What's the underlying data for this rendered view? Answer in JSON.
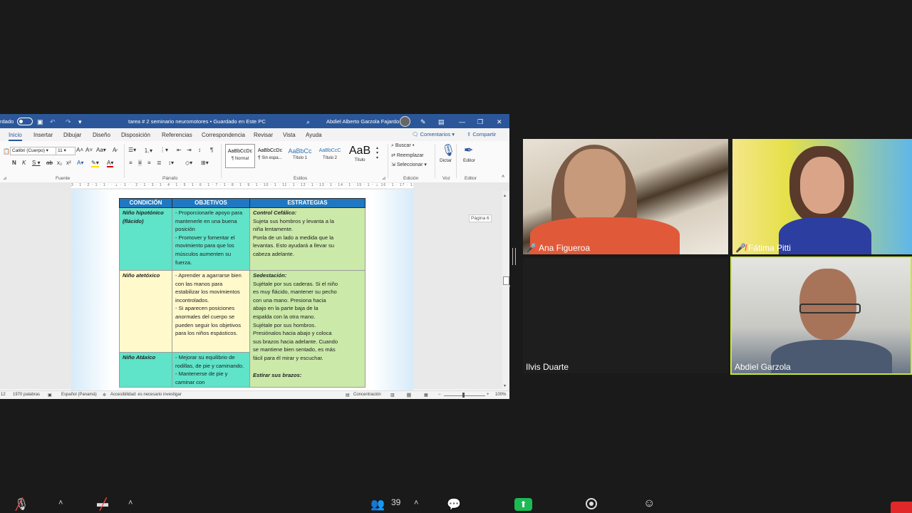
{
  "word": {
    "autosave_label": "rdado",
    "doc_title": "tarea # 2 seminario neuromotores • Guardado en Este PC",
    "user_name": "Abdiel Alberto Garzola Fajardo",
    "tabs": [
      "Inicio",
      "Insertar",
      "Dibujar",
      "Diseño",
      "Disposición",
      "Referencias",
      "Correspondencia",
      "Revisar",
      "Vista",
      "Ayuda"
    ],
    "comments_button": "Comentarios",
    "share_button": "Compartir",
    "font_name": "Calibri (Cuerpo)",
    "font_size": "11",
    "styles": [
      {
        "preview": "AaBbCcDc",
        "label": "¶ Normal"
      },
      {
        "preview": "AaBbCcDc",
        "label": "¶ Sin espa..."
      },
      {
        "preview": "AaBbCc",
        "label": "Título 1"
      },
      {
        "preview": "AaBbCcC",
        "label": "Título 2"
      },
      {
        "preview": "AaB",
        "label": "Título"
      }
    ],
    "edit_buttons": [
      "Buscar",
      "Reemplazar",
      "Seleccionar"
    ],
    "dictate_label": "Dictar",
    "editor_label": "Editor",
    "group_labels": {
      "fuente": "Fuente",
      "parrafo": "Párrafo",
      "estilos": "Estilos",
      "edicion": "Edición",
      "voz": "Voz",
      "editor": "Editor"
    },
    "ruler_text": "3 · 1 · 2 · 1 · 1 · · ⊥ · 1 · · 2 · 1 · 3 · 1 · 4 · 1 · 5 · 1 · 6 · 1 · 7 · 1 · 8 · 1 · 9 · 1 · 10 · 1 · 11 · 1 · 12 · 1 · 13 · 1 · 14 · 1 · 15 · 1 · ⊥ 16 · 1 · 17 · 1 · 18 ·",
    "page_indicator": "Página 6",
    "status": {
      "page_num": "12",
      "word_count": "1970 palabras",
      "language": "Español (Panamá)",
      "accessibility": "Accesibilidad: es necesario investigar",
      "focus": "Concentración",
      "zoom": "100%"
    },
    "table": {
      "headers": [
        "CONDICIÓN",
        "OBJETIVOS",
        "ESTRATEGIAS"
      ],
      "rows": [
        {
          "condition": "Niño hipotónico (flácido)",
          "objectives": "- Proporcionarle apoyo para mantenerle en una buena posición\n- Promover y fomentar el movimiento para que los músculos aumenten su fuerza.",
          "strategy_title": "Control Cefálico:",
          "strategy_text": "Sujeta sus hombros y levanta a la niña lentamente.\nPonla de un lado a medida que la levantas. Esto ayudará a llevar su cabeza adelante."
        },
        {
          "condition": "Niño atetóxico",
          "objectives": "- Aprender a agarrarse bien con las manos para estabilizar los movimientos incontrolados.\n- Si aparecen posiciones anormales del cuerpo se pueden seguir los objetivos para los niños espásticos.",
          "strategy_title": "Sedestación:",
          "strategy_text": "Sujétale por sus caderas. Si el niño es muy flácido, mantener su pecho con una mano. Presiona hacia abajo en la parte baja de la espalda con la otra mano.\nSujétale por sus hombros. Presiónalos hacia abajo y coloca sus brazos hacia adelante. Cuando se mantiene bien sentado, es más fácil para él mirar y escuchar."
        },
        {
          "condition": "Niño Atáxico",
          "objectives": "- Mejorar su equilibrio de rodillas, de pie y caminando.\n- Mantenerse de pie y caminar con",
          "strategy_title": "Estirar sus brazos:",
          "strategy_text": ""
        }
      ]
    }
  },
  "participants": [
    {
      "name": "Ana Figueroa",
      "muted": true
    },
    {
      "name": "Fátima Pitti",
      "muted": true
    },
    {
      "name": "Ilvis Duarte",
      "muted": false
    },
    {
      "name": "Abdiel Garzola",
      "muted": false
    }
  ],
  "toolbar": {
    "participant_count": "39",
    "icons": [
      "mic-muted-icon",
      "video-off-icon",
      "participants-icon",
      "chat-icon",
      "share-screen-icon",
      "record-icon",
      "reactions-icon"
    ]
  },
  "colors": {
    "word_blue": "#2b579a",
    "table_header": "#1f78c1",
    "teal_cell": "#5fe3c9",
    "yellow_cell": "#fff9cc",
    "green_cell": "#cbe9a9",
    "share_green": "#1db954",
    "active_speaker_border": "#c8e63c"
  }
}
